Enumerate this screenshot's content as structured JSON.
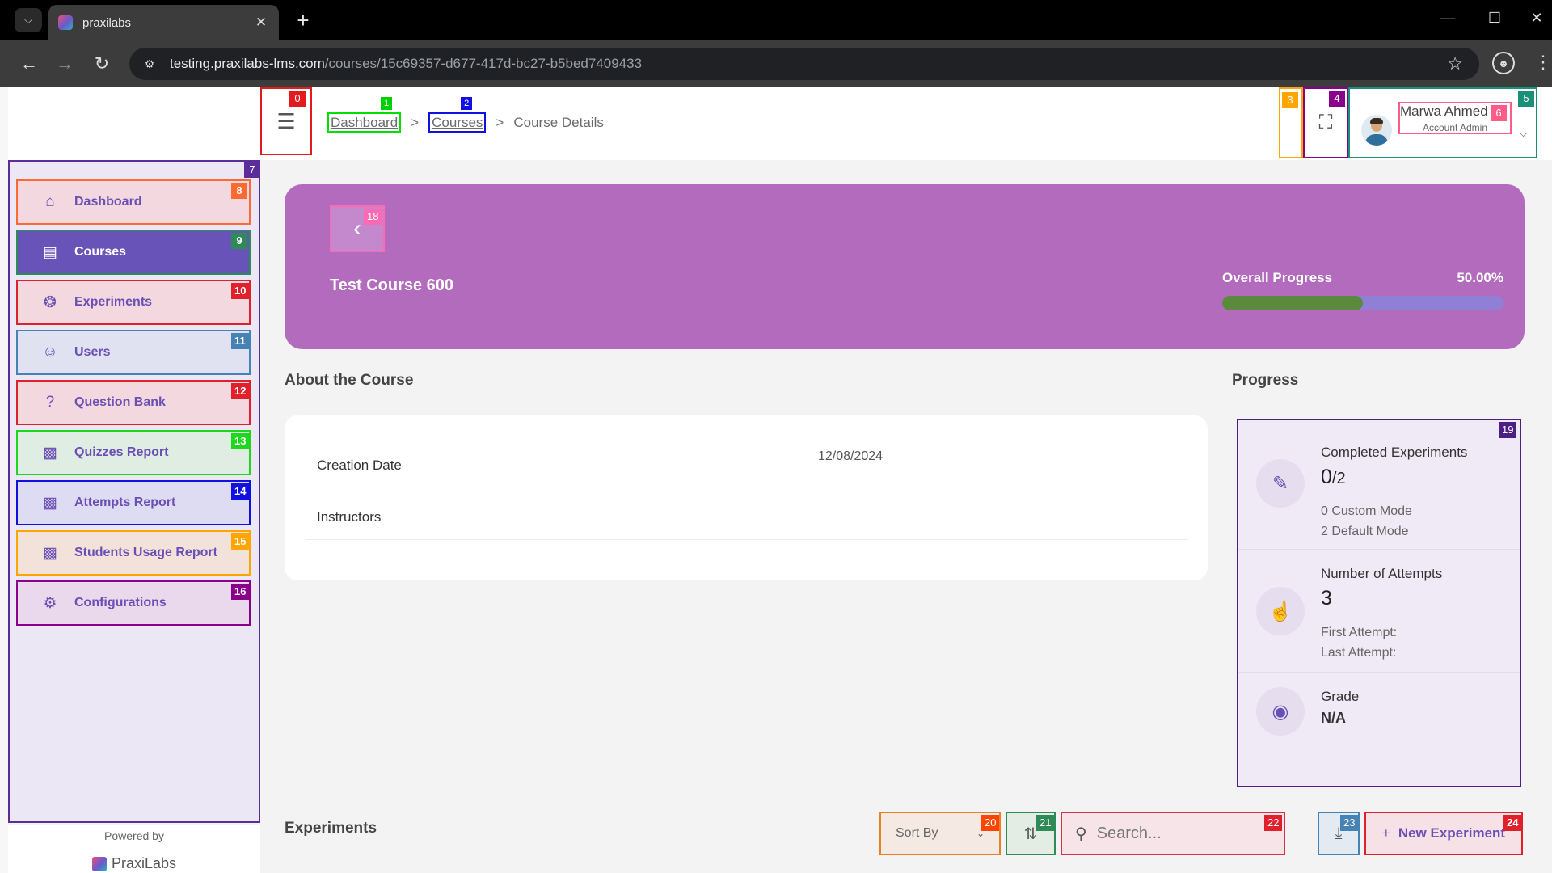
{
  "browser": {
    "tab_title": "praxilabs",
    "url_host": "testing.praxilabs-lms.com",
    "url_path": "/courses/15c69357-d677-417d-bc27-b5bed7409433"
  },
  "breadcrumb": {
    "dashboard": "Dashboard",
    "courses": "Courses",
    "current": "Course Details",
    "sep": ">"
  },
  "user": {
    "name": "Marwa Ahmed",
    "role": "Account Admin"
  },
  "sidebar": {
    "items": [
      {
        "label": "Dashboard",
        "icon": "home-icon"
      },
      {
        "label": "Courses",
        "icon": "book-icon",
        "active": true
      },
      {
        "label": "Experiments",
        "icon": "aperture-icon"
      },
      {
        "label": "Users",
        "icon": "user-icon"
      },
      {
        "label": "Question Bank",
        "icon": "question-icon"
      },
      {
        "label": "Quizzes Report",
        "icon": "report-icon"
      },
      {
        "label": "Attempts Report",
        "icon": "report-icon"
      },
      {
        "label": "Students Usage Report",
        "icon": "report-icon"
      },
      {
        "label": "Configurations",
        "icon": "gear-icon"
      }
    ],
    "powered_by": "Powered by",
    "logo_text": "PraxiLabs"
  },
  "course": {
    "title": "Test Course 600",
    "progress_label": "Overall Progress",
    "progress_text": "50.00%",
    "progress_fraction": 0.5
  },
  "about": {
    "heading": "About the Course",
    "creation_label": "Creation Date",
    "creation_value": "12/08/2024",
    "instructors_label": "Instructors",
    "instructors_value": ""
  },
  "progress_section": {
    "heading": "Progress",
    "completed_title": "Completed Experiments",
    "completed_value": "0",
    "completed_total": "/2",
    "custom_mode": "0 Custom Mode",
    "default_mode": "2 Default Mode",
    "attempts_title": "Number of Attempts",
    "attempts_value": "3",
    "first_attempt": "First Attempt:",
    "last_attempt": "Last Attempt:",
    "grade_title": "Grade",
    "grade_value": "N/A"
  },
  "experiments": {
    "heading": "Experiments",
    "sort_by": "Sort By",
    "search_placeholder": "Search...",
    "new_button": "New Experiment"
  },
  "overlay_badges": [
    "0",
    "1",
    "2",
    "3",
    "4",
    "5",
    "6",
    "7",
    "8",
    "9",
    "10",
    "11",
    "12",
    "13",
    "14",
    "15",
    "16",
    "18",
    "19",
    "20",
    "21",
    "22",
    "23",
    "24"
  ],
  "colors": {
    "accent": "#6853b8",
    "hero": "#b26bbd",
    "progress_fill": "#5b8a3c",
    "progress_track": "#8f80d6"
  }
}
